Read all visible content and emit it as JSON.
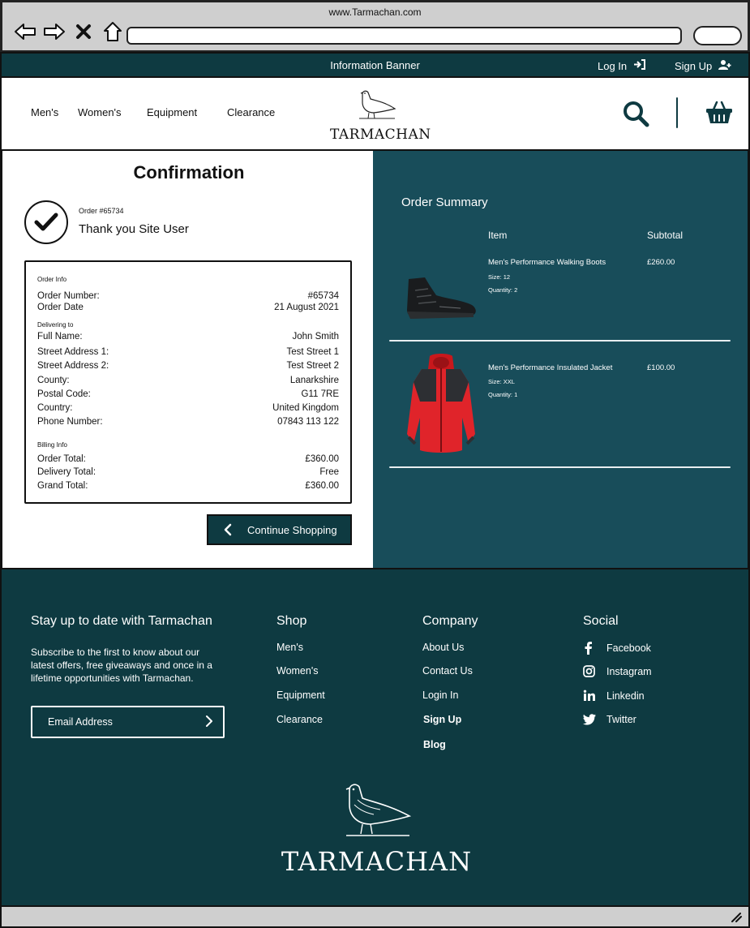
{
  "browser": {
    "url": "www.Tarmachan.com"
  },
  "banner": {
    "text": "Information Banner",
    "login": "Log In",
    "signup": "Sign Up"
  },
  "nav": {
    "items": [
      "Men's",
      "Women's",
      "Equipment",
      "Clearance"
    ]
  },
  "brand": "TARMACHAN",
  "confirmation": {
    "title": "Confirmation",
    "order_ref": "Order #65734",
    "thanks": "Thank you Site User",
    "order_info_heading": "Order Info",
    "order_number_label": "Order Number:",
    "order_number": "#65734",
    "order_date_label": "Order Date",
    "order_date": "21 August 2021",
    "delivering_heading": "Delivering to",
    "delivery": [
      {
        "label": "Full Name:",
        "value": "John Smith"
      },
      {
        "label": "Street Address 1:",
        "value": "Test Street 1"
      },
      {
        "label": "Street Address 2:",
        "value": "Test Street 2"
      },
      {
        "label": "County:",
        "value": "Lanarkshire"
      },
      {
        "label": "Postal Code:",
        "value": "G11 7RE"
      },
      {
        "label": "Country:",
        "value": "United Kingdom"
      },
      {
        "label": "Phone Number:",
        "value": "07843 113 122"
      }
    ],
    "billing_heading": "Billing Info",
    "billing": [
      {
        "label": "Order Total:",
        "value": "£360.00"
      },
      {
        "label": "Delivery Total:",
        "value": "Free"
      },
      {
        "label": "Grand Total:",
        "value": "£360.00"
      }
    ],
    "continue_label": "Continue Shopping"
  },
  "summary": {
    "title": "Order Summary",
    "col_item": "Item",
    "col_subtotal": "Subtotal",
    "items": [
      {
        "name": "Men's Performance Walking Boots",
        "size": "Size: 12",
        "quantity": "Quantity: 2",
        "subtotal": "£260.00"
      },
      {
        "name": "Men's Performance Insulated Jacket",
        "size": "Size: XXL",
        "quantity": "Quantity: 1",
        "subtotal": "£100.00"
      }
    ]
  },
  "footer": {
    "newsletter_title": "Stay up to date with Tarmachan",
    "newsletter_text": "Subscribe to the first to know about our latest offers, free giveaways and once in a lifetime opportunities with Tarmachan.",
    "email_placeholder": "Email Address",
    "shop_title": "Shop",
    "shop_links": [
      "Men's",
      "Women's",
      "Equipment",
      "Clearance"
    ],
    "company_title": "Company",
    "company_links": [
      "About Us",
      "Contact Us",
      "Login In",
      "Sign Up",
      "Blog"
    ],
    "social_title": "Social",
    "social_links": [
      "Facebook",
      "Instagram",
      "Linkedin",
      "Twitter"
    ]
  },
  "colors": {
    "banner_bg": "#0e3a41",
    "summary_bg": "#184d5a",
    "footer_bg": "#0e3a41",
    "chrome_bg": "#cfcfcf"
  },
  "icons": [
    "back-arrow-icon",
    "forward-arrow-icon",
    "close-icon",
    "home-icon",
    "login-icon",
    "add-user-icon",
    "search-icon",
    "basket-icon",
    "checkmark-icon",
    "chevron-left-icon",
    "chevron-right-icon",
    "facebook-icon",
    "instagram-icon",
    "linkedin-icon",
    "twitter-icon",
    "grouse-logo-icon",
    "resize-grip-icon"
  ]
}
